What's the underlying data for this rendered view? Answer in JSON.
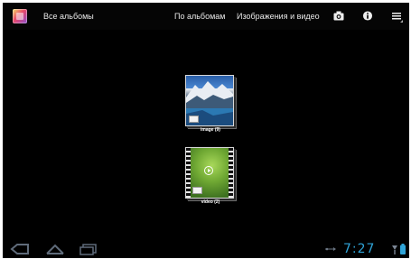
{
  "actionbar": {
    "app_icon": "gallery-icon",
    "title": "Все альбомы",
    "tabs": [
      {
        "label": "По альбомам"
      },
      {
        "label": "Изображения и видео"
      }
    ],
    "icons": [
      "camera-icon",
      "info-icon",
      "menu-icon"
    ]
  },
  "albums": [
    {
      "label": "image (9)",
      "kind": "image"
    },
    {
      "label": "video (2)",
      "kind": "video"
    }
  ],
  "sysbar": {
    "nav_icons": [
      "back-icon",
      "home-icon",
      "recent-apps-icon"
    ],
    "time": "7:27",
    "status_icons": [
      "usb-icon",
      "signal-icon",
      "battery-icon"
    ]
  },
  "colors": {
    "background": "#000000",
    "clock": "#2fa4d8",
    "text": "#e8e8e8"
  }
}
